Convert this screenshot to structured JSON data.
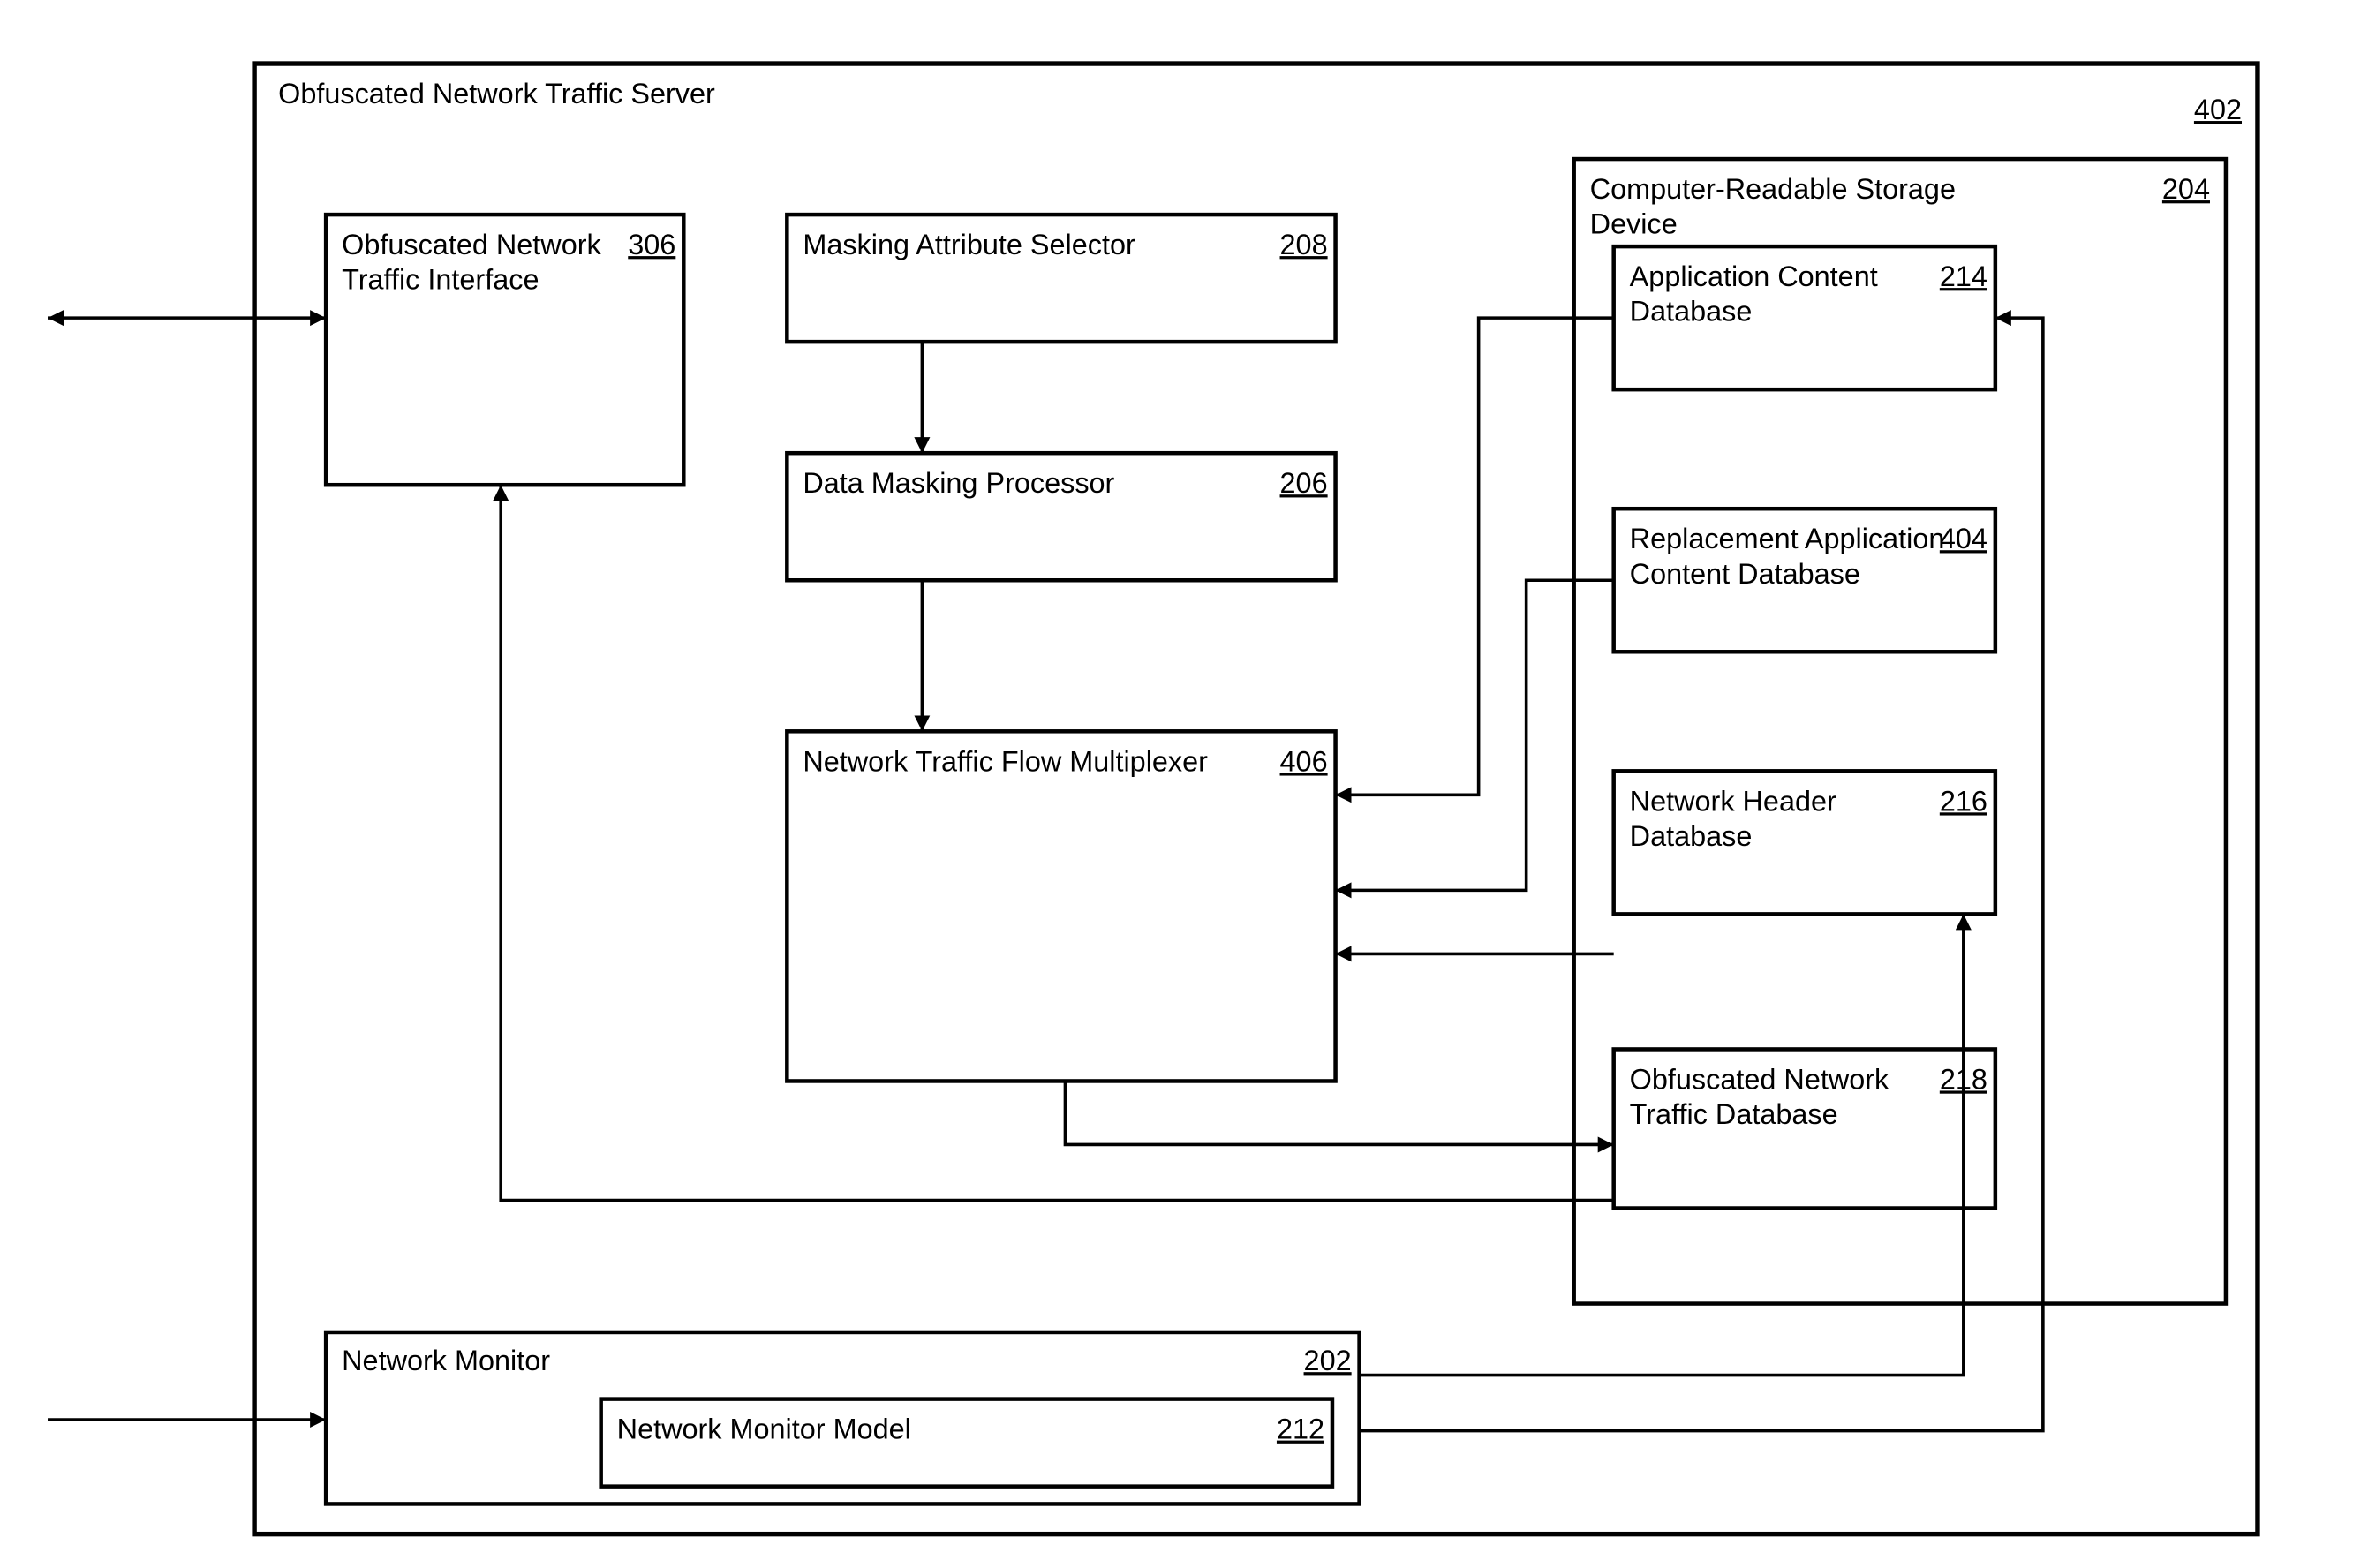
{
  "diagram": {
    "container": {
      "label": "Obfuscated Network Traffic Server",
      "ref": "402"
    },
    "interface": {
      "label1": "Obfuscated Network",
      "label2": "Traffic Interface",
      "ref": "306"
    },
    "selector": {
      "label": "Masking Attribute Selector",
      "ref": "208"
    },
    "processor": {
      "label": "Data Masking Processor",
      "ref": "206"
    },
    "multiplexer": {
      "label": "Network Traffic Flow Multiplexer",
      "ref": "406"
    },
    "storage": {
      "label1": "Computer-Readable Storage",
      "label2": "Device",
      "ref": "204"
    },
    "appdb": {
      "label1": "Application Content",
      "label2": "Database",
      "ref": "214"
    },
    "repdb": {
      "label1": "Replacement Application",
      "label2": "Content Database",
      "ref": "404"
    },
    "hdrdb": {
      "label1": "Network Header",
      "label2": "Database",
      "ref": "216"
    },
    "obfdb": {
      "label1": "Obfuscated Network",
      "label2": "Traffic Database",
      "ref": "218"
    },
    "monitor": {
      "label": "Network Monitor",
      "ref": "202"
    },
    "monitormodel": {
      "label": "Network Monitor Model",
      "ref": "212"
    }
  }
}
